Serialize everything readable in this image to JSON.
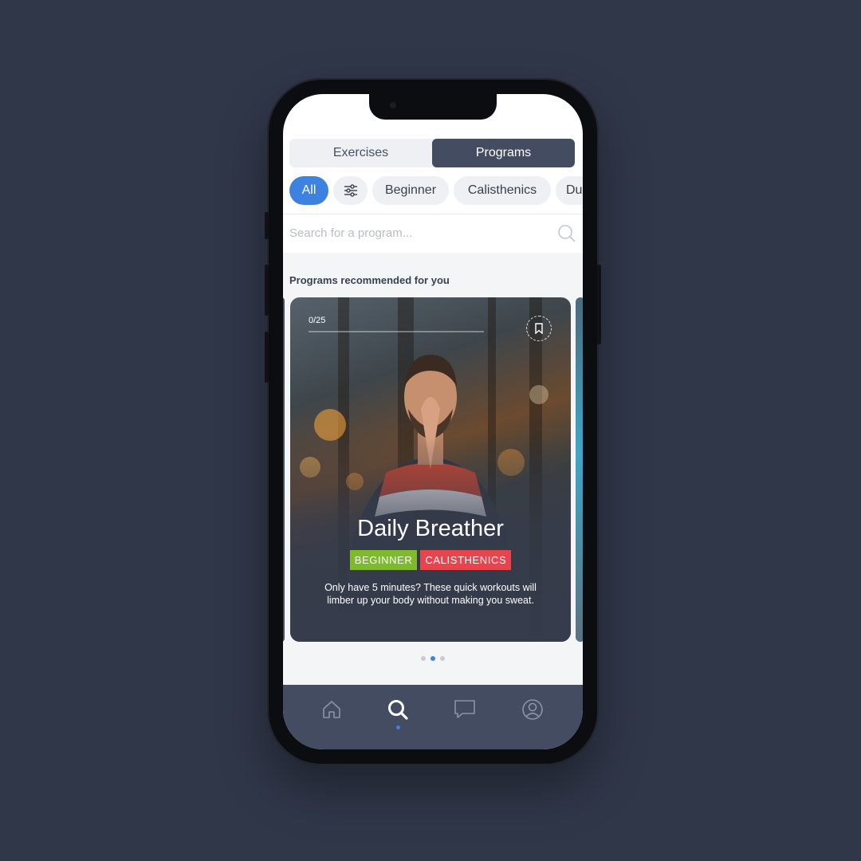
{
  "segmented": {
    "exercises": "Exercises",
    "programs": "Programs",
    "active": "Programs"
  },
  "filters": {
    "all": "All",
    "chips": [
      "Beginner",
      "Calisthenics",
      "Du"
    ]
  },
  "search": {
    "placeholder": "Search for a program..."
  },
  "section_title": "Programs recommended for you",
  "card": {
    "progress": "0/25",
    "title": "Daily Breather",
    "tags": [
      "BEGINNER",
      "CALISTHENICS"
    ],
    "description": "Only have 5 minutes? These quick workouts will limber up your body without making you sweat."
  },
  "pager": {
    "count": 3,
    "active_index": 1
  },
  "tabbar": {
    "items": [
      "home-icon",
      "search-icon",
      "chat-icon",
      "profile-icon"
    ],
    "active": "search-icon"
  },
  "colors": {
    "accent": "#3d82e0",
    "tab_active": "#434c61",
    "tag_green": "#7dbb2c",
    "tag_red": "#e8434f",
    "background": "#303749"
  }
}
